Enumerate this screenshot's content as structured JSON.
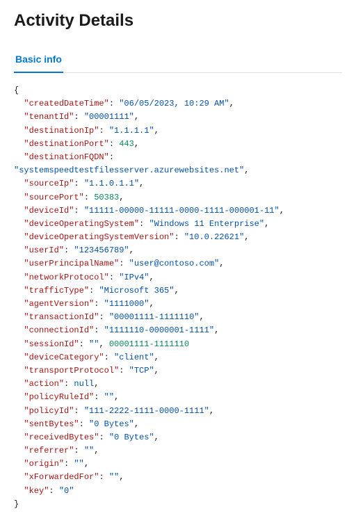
{
  "page": {
    "title": "Activity Details"
  },
  "tabs": [
    {
      "label": "Basic info",
      "active": true
    }
  ],
  "json_data": {
    "createdDateTime": "06/05/2023, 10:29 AM",
    "tenantId": "00001111",
    "destinationIp": "1.1.1.1",
    "destinationPort": 443,
    "destinationFQDN": "systemspeedtestfilesserver.azurewebsites.net",
    "sourceIp": "1.1.0.1.1",
    "sourcePort": 50383,
    "deviceId": "11111-00000-11111-0000-1111-000001-11",
    "deviceOperatingSystem": "Windows 11 Enterprise",
    "deviceOperatingSystemVersion": "10.0.22621",
    "userId": "123456789",
    "userPrincipalName": "user@contoso.com",
    "networkProtocol": "IPv4",
    "trafficType": "Microsoft 365",
    "agentVersion": "1111000",
    "transactionId": "00001111-1111110",
    "connectionId": "1111110-0000001-1111",
    "sessionId_label": "sessionId",
    "sessionId_value": "",
    "sessionId_extra": "00001111-1111110",
    "deviceCategory": "client",
    "transportProtocol": "TCP",
    "action_null": true,
    "policyRuleId": "",
    "policyId": "111-2222-1111-0000-1111",
    "sentBytes": "0 Bytes",
    "receivedBytes": "0 Bytes",
    "referrer": "",
    "origin": "",
    "xForwardedFor": "",
    "key": "0"
  }
}
